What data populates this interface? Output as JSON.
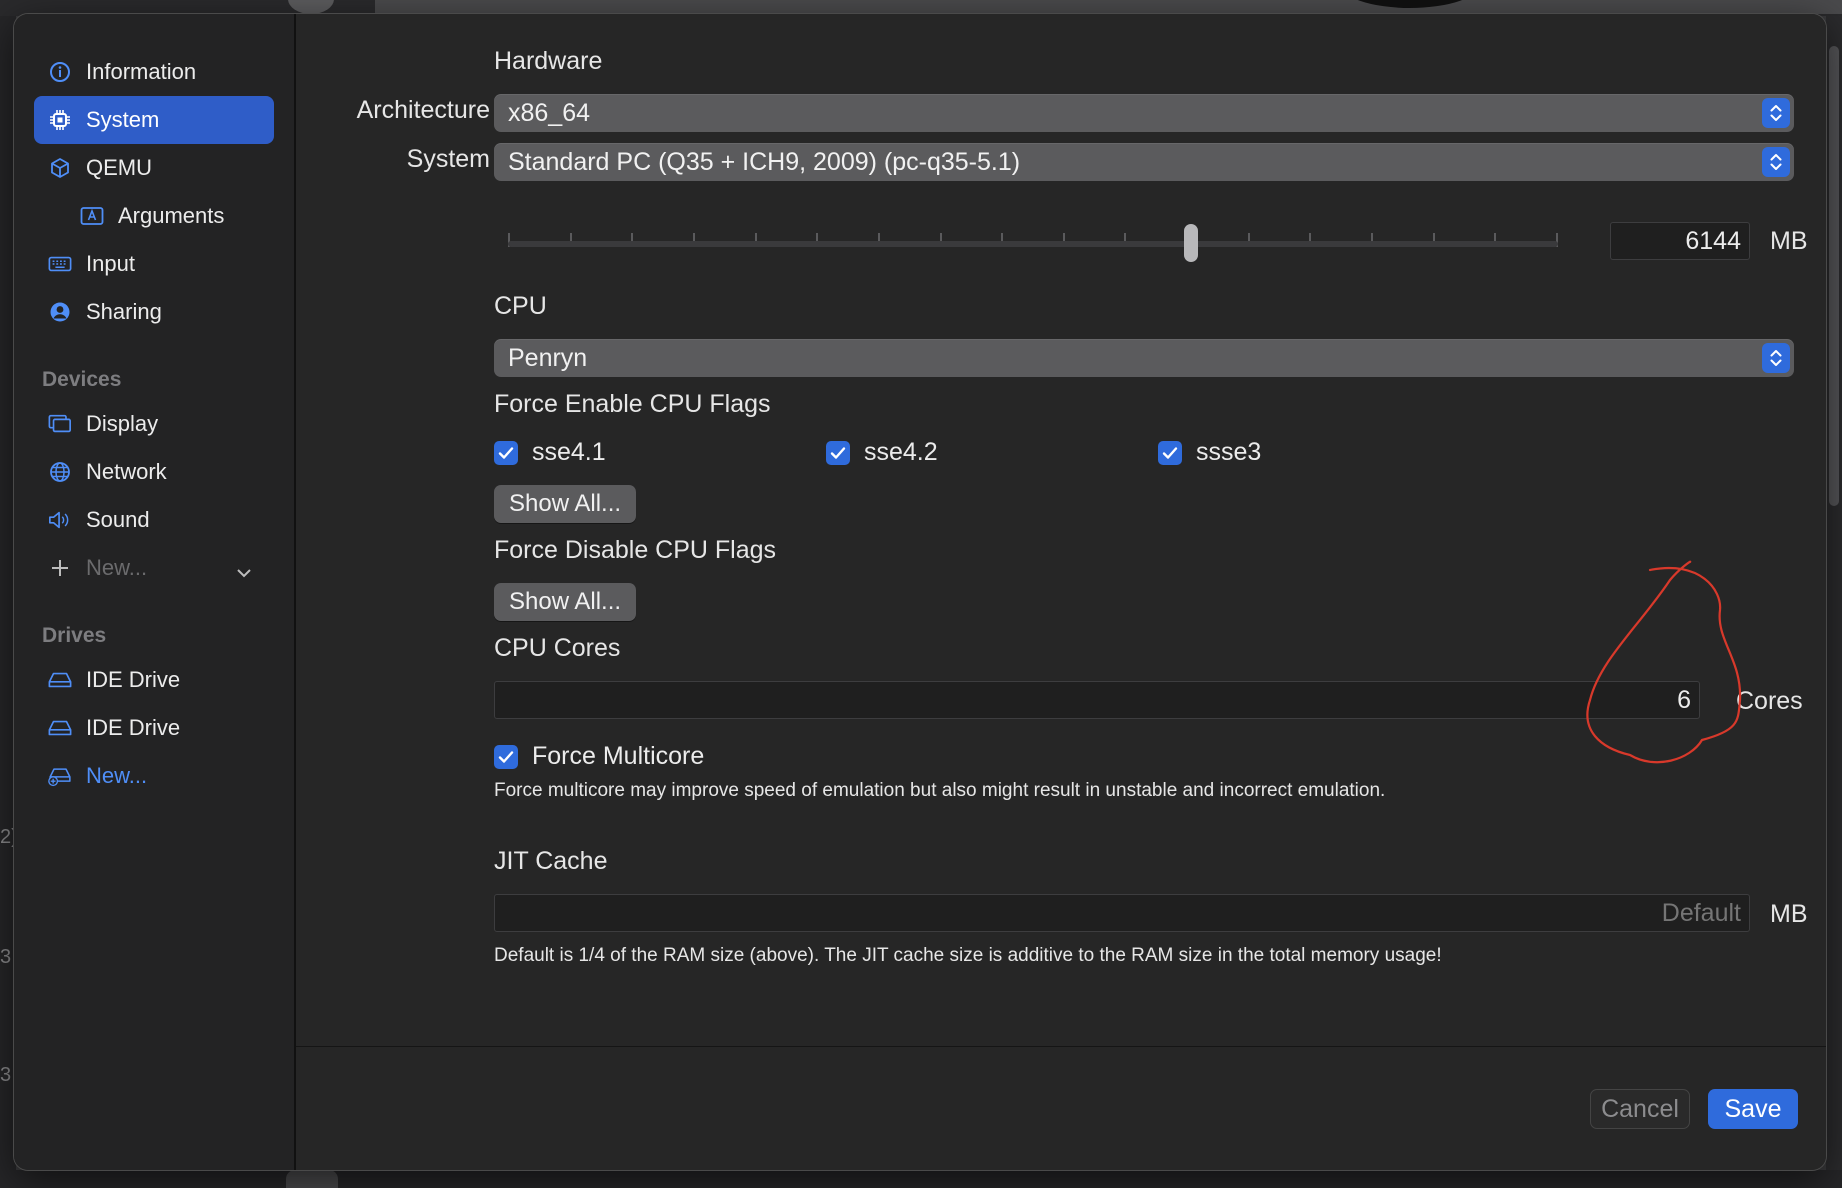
{
  "sidebar": {
    "items": [
      {
        "label": "Information",
        "icon": "info-icon"
      },
      {
        "label": "System",
        "icon": "chip-icon",
        "selected": true
      },
      {
        "label": "QEMU",
        "icon": "cube-icon"
      },
      {
        "label": "Arguments",
        "icon": "text-box-icon"
      },
      {
        "label": "Input",
        "icon": "keyboard-icon"
      },
      {
        "label": "Sharing",
        "icon": "person-circle-icon"
      }
    ],
    "devices_header": "Devices",
    "devices": [
      {
        "label": "Display",
        "icon": "display-icon"
      },
      {
        "label": "Network",
        "icon": "globe-icon"
      },
      {
        "label": "Sound",
        "icon": "speaker-icon"
      }
    ],
    "new_device": "New...",
    "drives_header": "Drives",
    "drives": [
      {
        "label": "IDE Drive",
        "icon": "drive-icon"
      },
      {
        "label": "IDE Drive",
        "icon": "drive-icon"
      }
    ],
    "new_drive": "New..."
  },
  "hardware": {
    "title": "Hardware",
    "architecture_label": "Architecture",
    "architecture_value": "x86_64",
    "system_label": "System",
    "system_value": "Standard PC (Q35 + ICH9, 2009) (pc-q35-5.1)",
    "memory_value": "6144",
    "memory_unit": "MB",
    "memory_slider_fraction": 0.65
  },
  "cpu": {
    "title": "CPU",
    "model_value": "Penryn",
    "force_enable_title": "Force Enable CPU Flags",
    "flags": [
      {
        "label": "sse4.1",
        "checked": true
      },
      {
        "label": "sse4.2",
        "checked": true
      },
      {
        "label": "ssse3",
        "checked": true
      }
    ],
    "show_all_enable": "Show All...",
    "force_disable_title": "Force Disable CPU Flags",
    "show_all_disable": "Show All...",
    "cores_title": "CPU Cores",
    "cores_value": "6",
    "cores_unit": "Cores",
    "force_multicore_label": "Force Multicore",
    "force_multicore_checked": true,
    "force_multicore_help": "Force multicore may improve speed of emulation but also might result in unstable and incorrect emulation."
  },
  "jit": {
    "title": "JIT Cache",
    "placeholder": "Default",
    "unit": "MB",
    "help": "Default is 1/4 of the RAM size (above). The JIT cache size is additive to the RAM size in the total memory usage!"
  },
  "footer": {
    "cancel": "Cancel",
    "save": "Save"
  },
  "colors": {
    "accent": "#2f6bdc",
    "selection": "#2f5dc8",
    "annotation": "#d8392b"
  }
}
